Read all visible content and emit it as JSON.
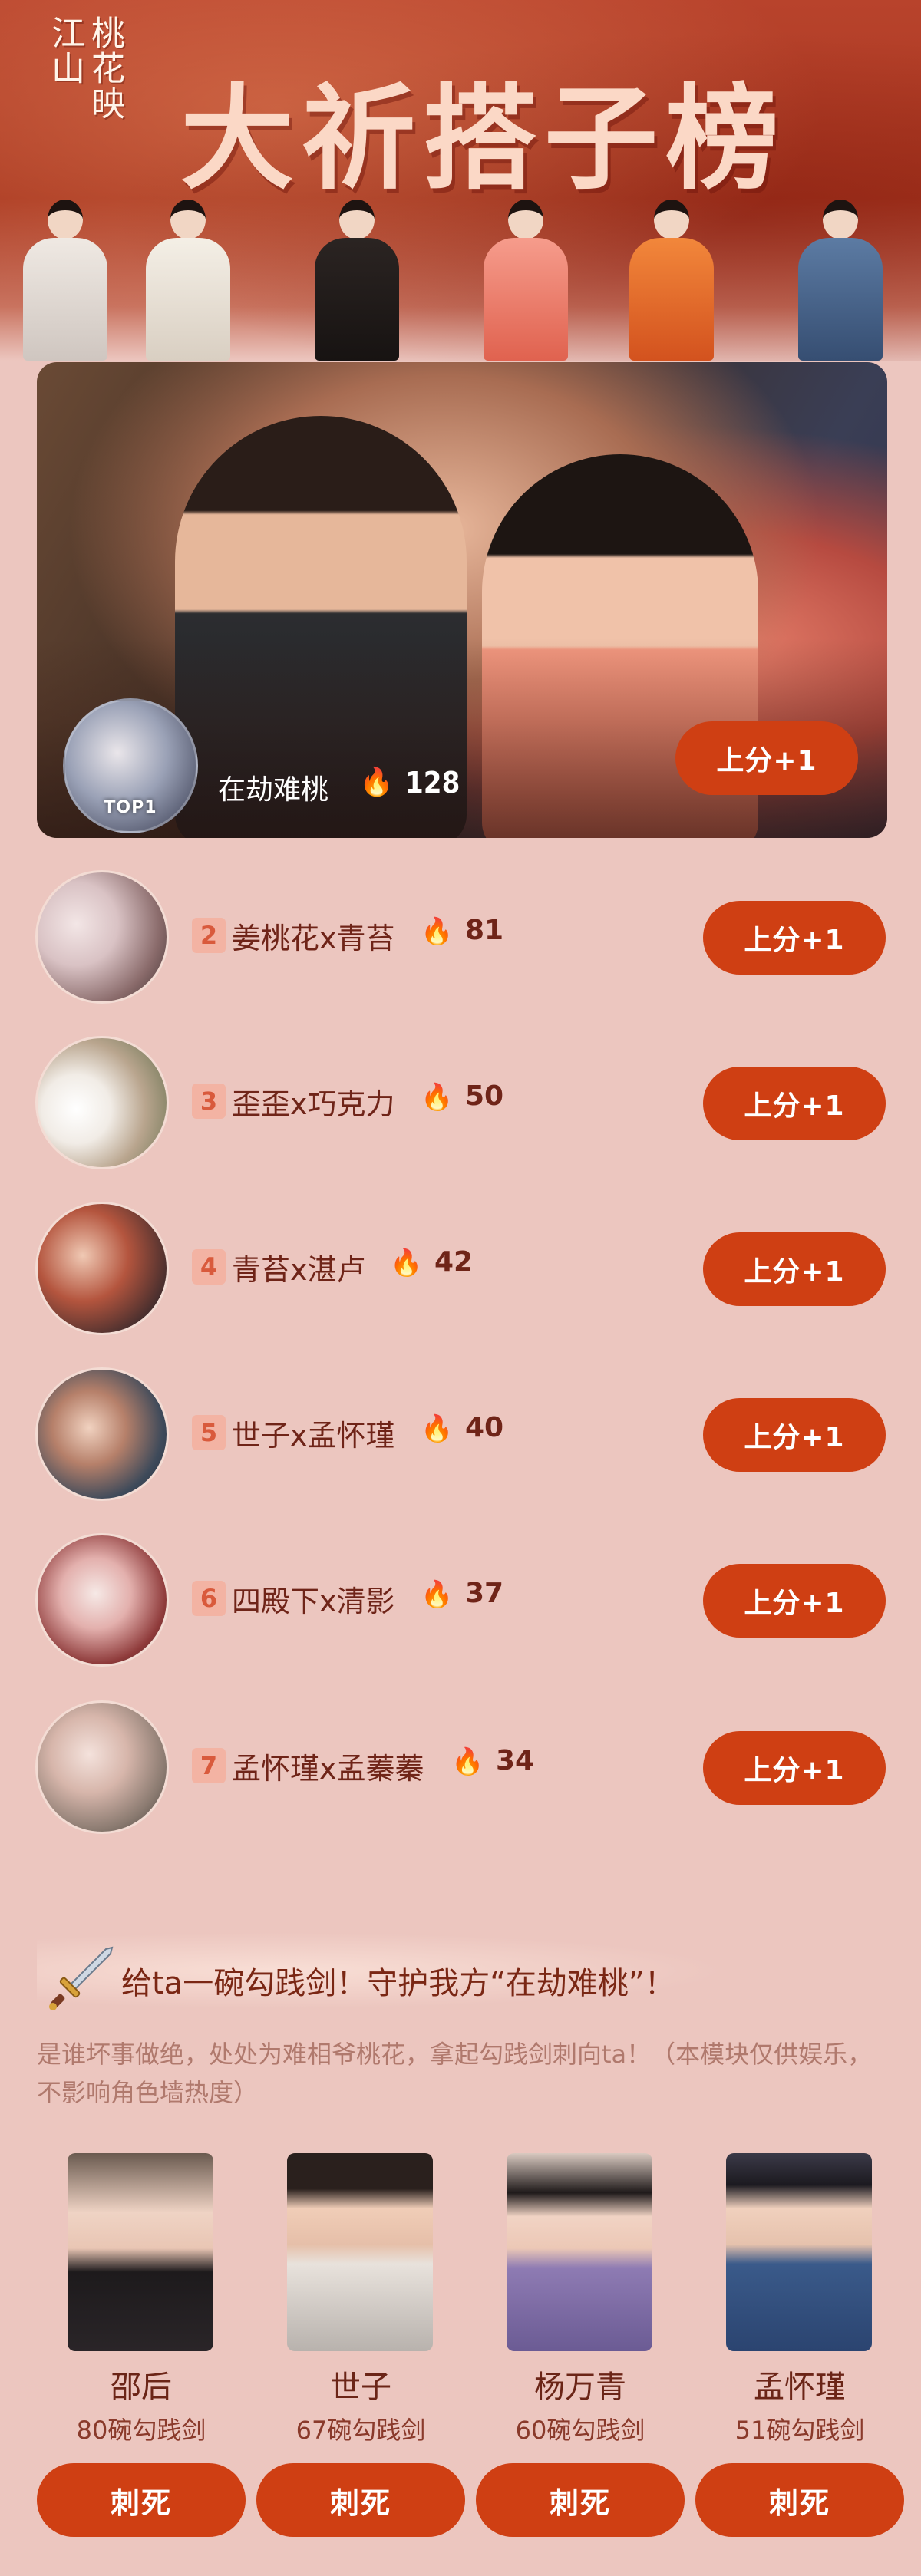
{
  "banner": {
    "logo_text": "桃花映江山",
    "title": "大祈搭子榜"
  },
  "top1": {
    "badge": "TOP1",
    "name": "在劫难桃",
    "fire_icon": "fire-icon",
    "score": "128",
    "vote_label": "上分+1"
  },
  "ranks": [
    {
      "rank": "2",
      "name": "姜桃花x青苔",
      "score": "81",
      "vote_label": "上分+1"
    },
    {
      "rank": "3",
      "name": "歪歪x巧克力",
      "score": "50",
      "vote_label": "上分+1"
    },
    {
      "rank": "4",
      "name": "青苔x湛卢",
      "score": "42",
      "vote_label": "上分+1"
    },
    {
      "rank": "5",
      "name": "世子x孟怀瑾",
      "score": "40",
      "vote_label": "上分+1"
    },
    {
      "rank": "6",
      "name": "四殿下x清影",
      "score": "37",
      "vote_label": "上分+1"
    },
    {
      "rank": "7",
      "name": "孟怀瑾x孟蓁蓁",
      "score": "34",
      "vote_label": "上分+1"
    }
  ],
  "sword_section": {
    "icon": "sword-icon",
    "title": "给ta一碗勾践剑！守护我方“在劫难桃”！",
    "description": "是谁坏事做绝，处处为难相爷桃花，拿起勾践剑刺向ta！（本模块仅供娱乐，不影响角色墙热度）",
    "characters": [
      {
        "name": "邵后",
        "count": "80碗勾践剑",
        "button": "刺死"
      },
      {
        "name": "世子",
        "count": "67碗勾践剑",
        "button": "刺死"
      },
      {
        "name": "杨万青",
        "count": "60碗勾践剑",
        "button": "刺死"
      },
      {
        "name": "孟怀瑾",
        "count": "51碗勾践剑",
        "button": "刺死"
      }
    ]
  },
  "colors": {
    "page_bg": "#ecc6bf",
    "accent_button": "#cf3f13",
    "banner_red": "#a8361f",
    "text_dark": "#6f2418"
  }
}
